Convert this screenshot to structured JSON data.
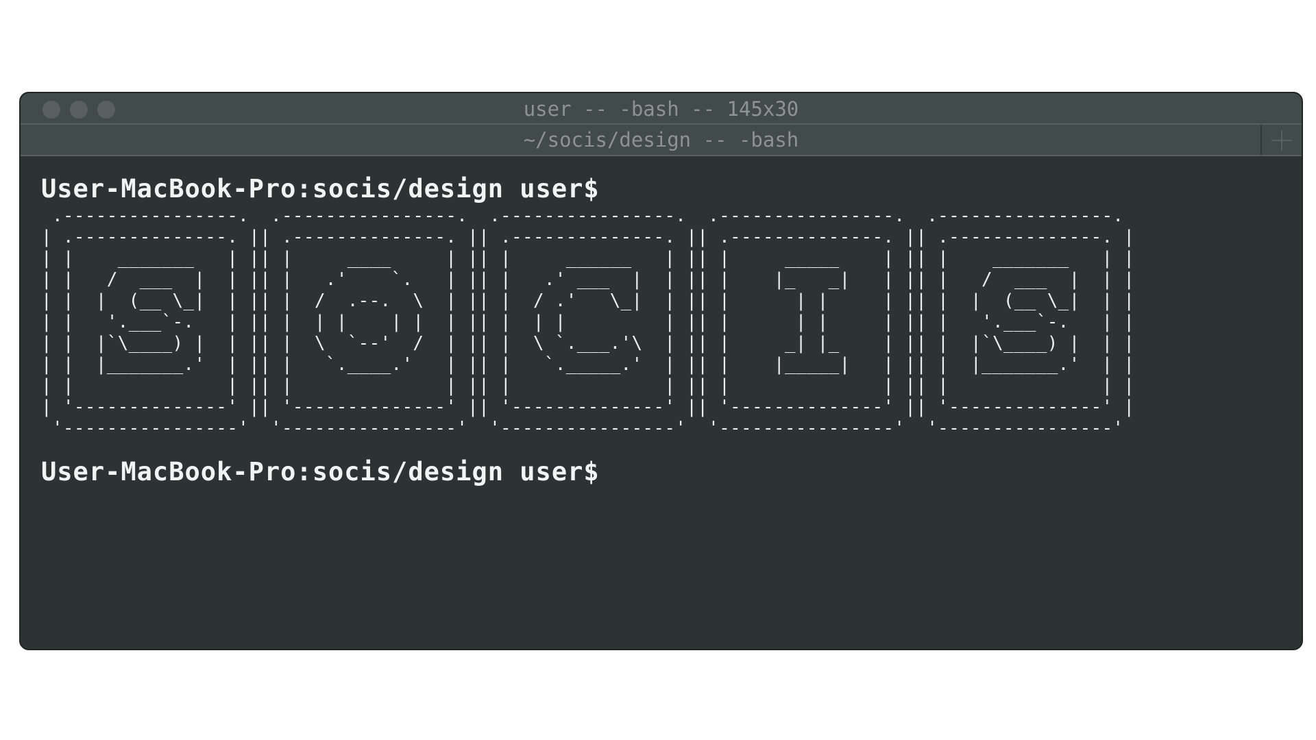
{
  "window": {
    "title": "user -- -bash -- 145x30"
  },
  "tabs": [
    {
      "label": "~/socis/design -- -bash"
    }
  ],
  "terminal": {
    "prompt_1": "User-MacBook-Pro:socis/design user$",
    "ascii_art": " .----------------.  .----------------.  .----------------.  .----------------.  .----------------.\n| .--------------. || .--------------. || .--------------. || .--------------. || .--------------. |\n| |    _______   | || |     ____     | || |     ______   | || |     _____    | || |    _______   | |\n| |   /  ___  |  | || |   .'    `.   | || |   .' ___  |  | || |    |_   _|   | || |   /  ___  |  | |\n| |  |  (__ \\_|  | || |  /  .--.  \\  | || |  / .'   \\_|  | || |      | |     | || |  |  (__ \\_|  | |\n| |   '.___`-.   | || |  | |    | |  | || |  | |         | || |      | |     | || |   '.___`-.   | |\n| |  |`\\____) |  | || |  \\  `--'  /  | || |  \\ `.___.'\\  | || |     _| |_    | || |  |`\\____) |  | |\n| |  |_______.'  | || |   `.____.'   | || |   `._____.'  | || |    |_____|   | || |  |_______.'  | |\n| |              | || |              | || |              | || |              | || |              | |\n| '--------------' || '--------------' || '--------------' || '--------------' || '--------------' |\n '----------------'  '----------------'  '----------------'  '----------------'  '----------------'",
    "prompt_2": "User-MacBook-Pro:socis/design user$"
  },
  "icons": {
    "close": "traffic-light-close",
    "minimize": "traffic-light-minimize",
    "zoom": "traffic-light-zoom",
    "new_tab": "plus-icon"
  },
  "colors": {
    "background": "#2d3333",
    "titlebar": "#414b4b",
    "text": "#f2f4f4",
    "title_text": "#8c9393"
  }
}
